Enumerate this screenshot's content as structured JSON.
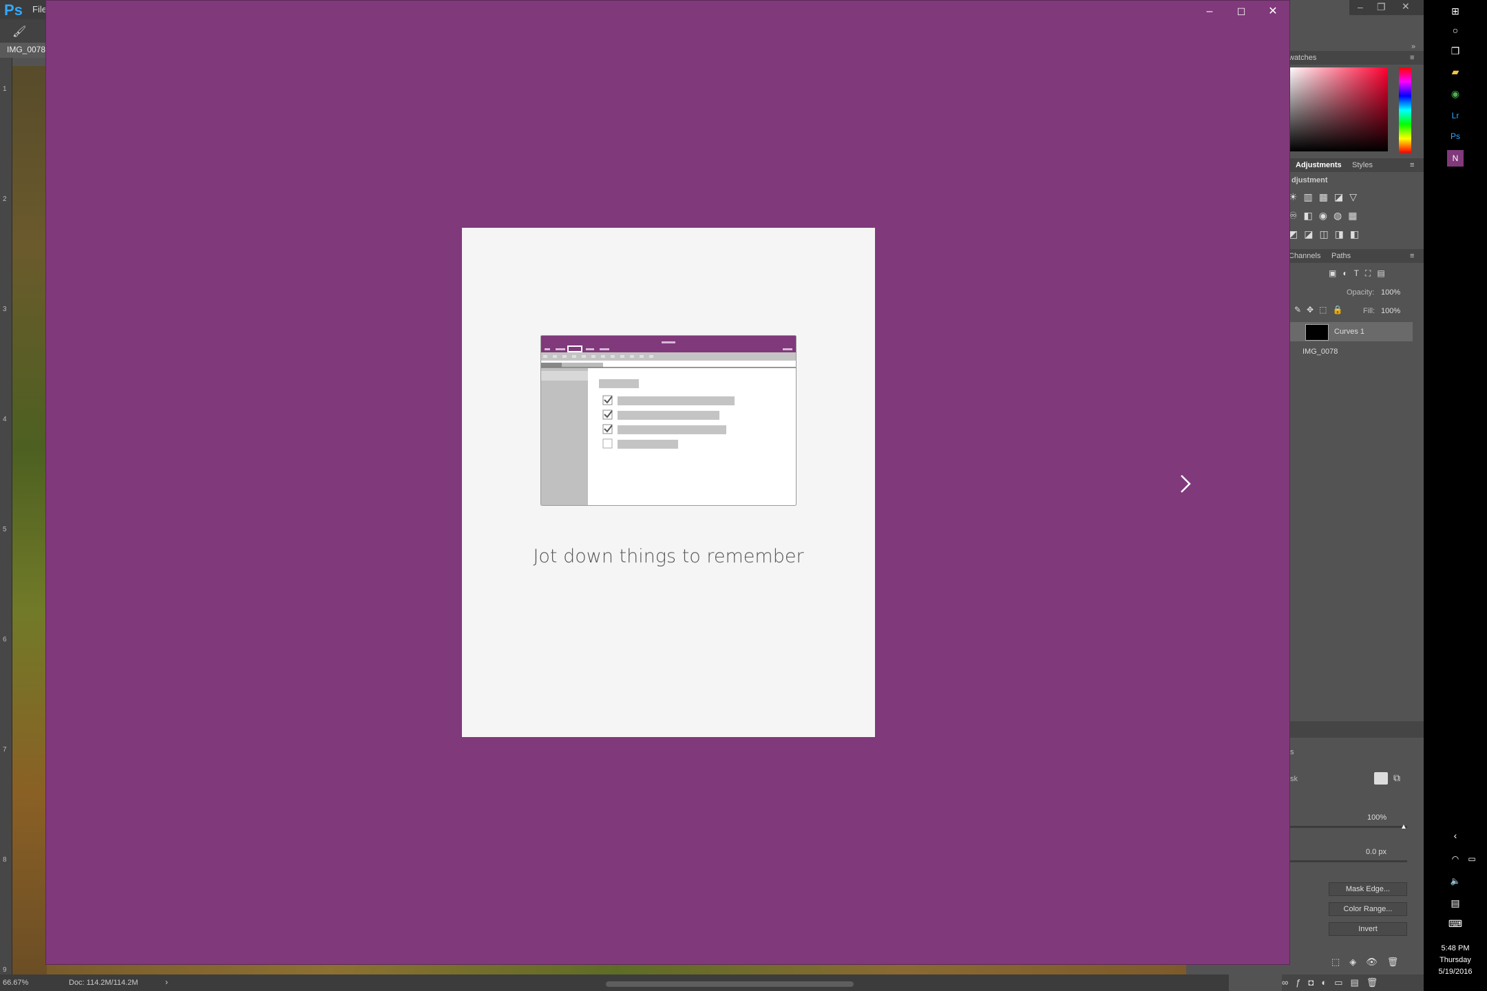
{
  "photoshop": {
    "logo": "Ps",
    "menu_file": "File",
    "document_tab": "IMG_0078",
    "ruler_numbers": [
      "1",
      "2",
      "3",
      "4",
      "5",
      "6",
      "7",
      "8",
      "9"
    ],
    "status_zoom": "66.67%",
    "status_doc": "Doc: 114.2M/114.2M",
    "panels": {
      "swatches_tab": "watches",
      "adjustments_tab": "Adjustments",
      "styles_tab": "Styles",
      "adjustment_label": "djustment",
      "channels_tab": "Channels",
      "paths_tab": "Paths",
      "opacity_label": "Opacity:",
      "opacity_value": "100%",
      "fill_label": "Fill:",
      "fill_value": "100%",
      "layers": [
        {
          "name": "Curves 1"
        },
        {
          "name": "IMG_0078"
        }
      ],
      "properties_fragment_1": "s",
      "properties_fragment_2": "sk",
      "density_value": "100%",
      "feather_value": "0.0 px",
      "mask_edge_button": "Mask Edge...",
      "color_range_button": "Color Range...",
      "invert_button": "Invert"
    }
  },
  "onenote": {
    "caption": "Jot down things to remember",
    "theme_color": "#80397b",
    "card_color": "#f6f5f6"
  },
  "taskbar": {
    "time": "5:48 PM",
    "day": "Thursday",
    "date": "5/19/2016"
  }
}
